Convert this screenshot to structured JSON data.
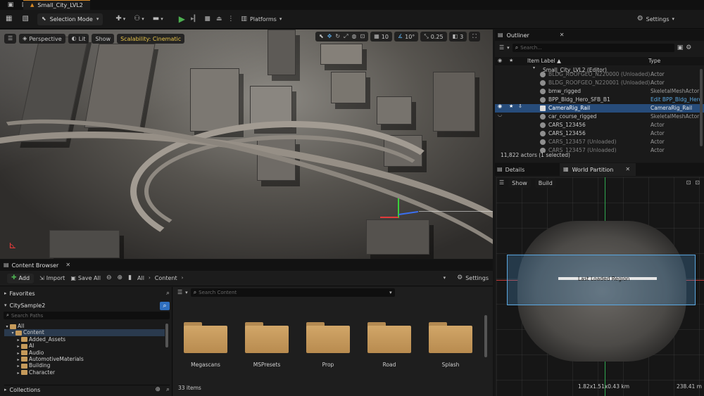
{
  "titlebar": {
    "level_tab": "Small_City_LVL2"
  },
  "toolbar": {
    "selection_mode": "Selection Mode",
    "platforms": "Platforms",
    "settings": "Settings"
  },
  "viewport": {
    "perspective": "Perspective",
    "lit": "Lit",
    "show": "Show",
    "scalability": "Scalability: Cinematic",
    "grid_snap": "10",
    "rot_snap": "10°",
    "scale_snap": "0.25",
    "camera_speed": "3"
  },
  "content_browser": {
    "tab_label": "Content Browser",
    "add_label": "Add",
    "import_label": "Import",
    "save_all_label": "Save All",
    "path_all": "All",
    "path_content": "Content",
    "settings_label": "Settings",
    "favorites": "Favorites",
    "project": "CitySample2",
    "search_paths_placeholder": "Search Paths",
    "search_content_placeholder": "Search Content",
    "collections": "Collections",
    "item_count": "33 items",
    "tree": [
      "All",
      "Content",
      "Added_Assets",
      "AI",
      "Audio",
      "AutomotiveMaterials",
      "Building",
      "Character"
    ],
    "folders": [
      "Megascans",
      "MSPresets",
      "Prop",
      "Road",
      "Splash"
    ]
  },
  "outliner": {
    "tab_label": "Outliner",
    "search_placeholder": "Search...",
    "col_label": "Item Label ▲",
    "col_type": "Type",
    "rows": [
      {
        "label": "Small_City_LVL2 (Editor)",
        "type": ""
      },
      {
        "label": "BLDG_ROOFGEO_N220000 (Unloaded)",
        "type": "Actor"
      },
      {
        "label": "BLDG_ROOFGEO_N220001 (Unloaded)",
        "type": "Actor"
      },
      {
        "label": "bmw_rigged",
        "type": "SkeletalMeshActor"
      },
      {
        "label": "BPP_Bldg_Hero_SFB_B1",
        "type": "Edit BPP_Bldg_Hero"
      },
      {
        "label": "CameraRig_Rail",
        "type": "CameraRig_Rail"
      },
      {
        "label": "car_course_rigged",
        "type": "SkeletalMeshActor"
      },
      {
        "label": "CARS_123456",
        "type": "Actor"
      },
      {
        "label": "CARS_123456",
        "type": "Actor"
      },
      {
        "label": "CARS_123457 (Unloaded)",
        "type": "Actor"
      },
      {
        "label": "CARS_123457 (Unloaded)",
        "type": "Actor"
      }
    ],
    "footer": "11,822 actors (1 selected)"
  },
  "world_partition": {
    "details_tab": "Details",
    "wp_tab": "World Partition",
    "show": "Show",
    "build": "Build",
    "region_label": "Last Loaded Region",
    "size_readout": "1.82x1.51x0.43 km",
    "zoom_readout": "238.41 m"
  },
  "colors": {
    "selection_blue": "#274c7a",
    "accent_orange": "#d88a27",
    "region_blue": "#5aa7e0",
    "folder_tan": "#c59a5a",
    "play_green": "#4caf50"
  }
}
